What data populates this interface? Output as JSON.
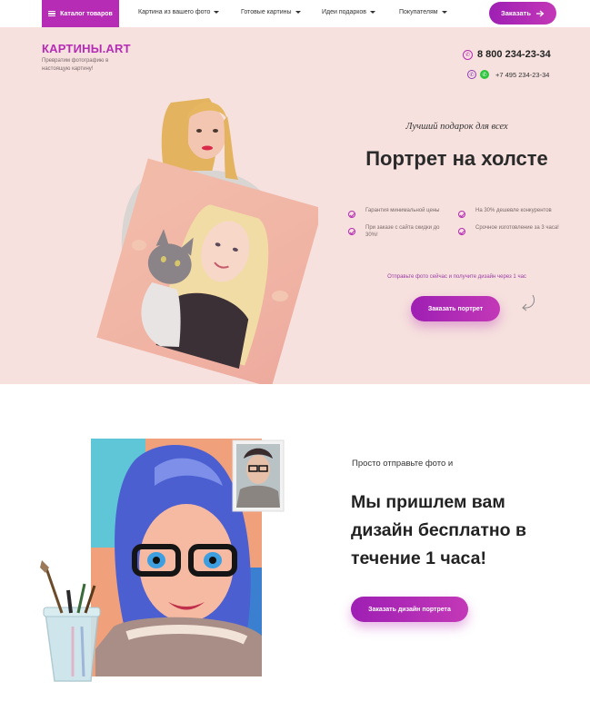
{
  "nav": {
    "catalog_label": "Каталог товаров",
    "items": [
      {
        "label": "Картина из вашего фото"
      },
      {
        "label": "Готовые картины"
      },
      {
        "label": "Идеи подарков"
      },
      {
        "label": "Покупателям"
      }
    ],
    "order_label": "Заказать"
  },
  "hero": {
    "logo": "КАРТИНЫ.ART",
    "tagline": "Превратим фотографию в настоящую картину!",
    "phone_main": "8 800 234-23-34",
    "phone_second": "+7 495 234-23-34",
    "subtitle": "Лучший подарок для всех",
    "title": "Портрет на холсте",
    "features": [
      "Гарантия минимальной цены",
      "На 30% дешевле конкурентов",
      "При заказе с сайта скидки до 30%!",
      "Срочное изготовление за 3 часа!"
    ],
    "send_hint": "Отправьте фото сейчас и получите дизайн через 1 час",
    "cta": "Заказать портрет"
  },
  "section2": {
    "kicker": "Просто отправьте фото и",
    "title": "Мы пришлем вам дизайн бесплатно в течение 1 часа!",
    "cta": "Заказать дизайн портрета"
  },
  "colors": {
    "accent": "#b62cb4",
    "hero_bg": "#f6e1de"
  },
  "icons": [
    "menu-icon",
    "chevron-down-icon",
    "arrow-right-icon",
    "phone-icon",
    "viber-icon",
    "whatsapp-icon",
    "check-icon",
    "curved-arrow-icon"
  ]
}
